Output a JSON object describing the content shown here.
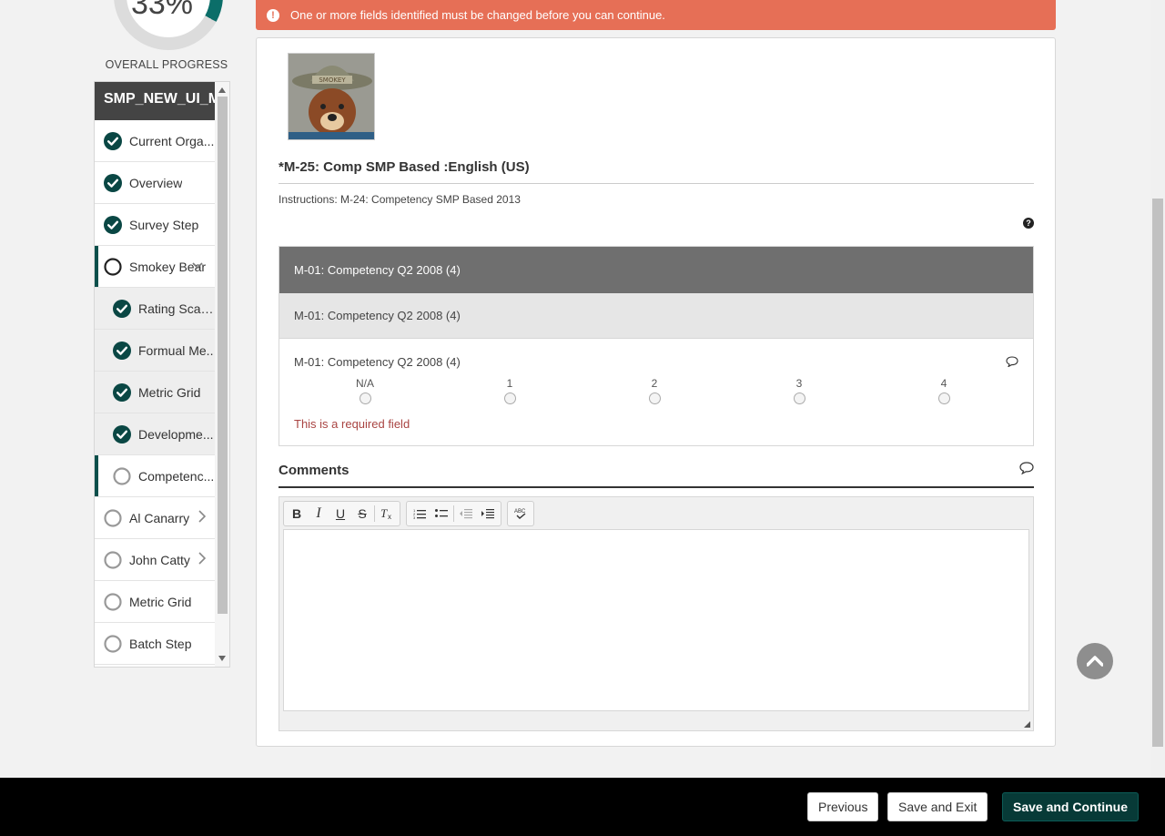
{
  "progress": {
    "percent_text": "33%",
    "fraction": 0.33,
    "label": "OVERALL PROGRESS",
    "color": "#0b6e69"
  },
  "sidebar": {
    "title": "SMP_NEW_UI_M",
    "items": [
      {
        "label": "Current Orga...",
        "state": "complete",
        "sub": false
      },
      {
        "label": "Overview",
        "state": "complete",
        "sub": false
      },
      {
        "label": "Survey Step",
        "state": "complete",
        "sub": false
      },
      {
        "label": "Smokey Bear",
        "state": "active",
        "sub": false
      },
      {
        "label": "Rating Scale..",
        "state": "complete",
        "sub": true
      },
      {
        "label": "Formual Me..",
        "state": "complete",
        "sub": true
      },
      {
        "label": "Metric Grid",
        "state": "complete",
        "sub": true
      },
      {
        "label": "Developme...",
        "state": "complete",
        "sub": true
      },
      {
        "label": "Competenc...",
        "state": "current",
        "sub": true
      },
      {
        "label": "Al Canarry",
        "state": "incomplete",
        "sub": false
      },
      {
        "label": "John Catty",
        "state": "incomplete",
        "sub": false
      },
      {
        "label": "Metric Grid",
        "state": "incomplete",
        "sub": false
      },
      {
        "label": "Batch Step",
        "state": "incomplete",
        "sub": false
      }
    ]
  },
  "error_banner": {
    "icon": "exclamation-icon",
    "text": "One or more fields identified must be changed before you can continue.",
    "color": "#e66f56"
  },
  "main": {
    "section_title": "*M-25: Comp SMP Based :English (US)",
    "instructions": "Instructions: M-24: Competency SMP Based 2013",
    "grid": {
      "header": "M-01: Competency Q2 2008 (4)",
      "subheader": "M-01: Competency Q2 2008 (4)",
      "row_label": "M-01: Competency Q2 2008 (4)",
      "options": [
        "N/A",
        "1",
        "2",
        "3",
        "4"
      ],
      "required_message": "This is a required field"
    },
    "comments_title": "Comments"
  },
  "footer": {
    "previous": "Previous",
    "save_exit": "Save and Exit",
    "save_continue": "Save and Continue"
  }
}
